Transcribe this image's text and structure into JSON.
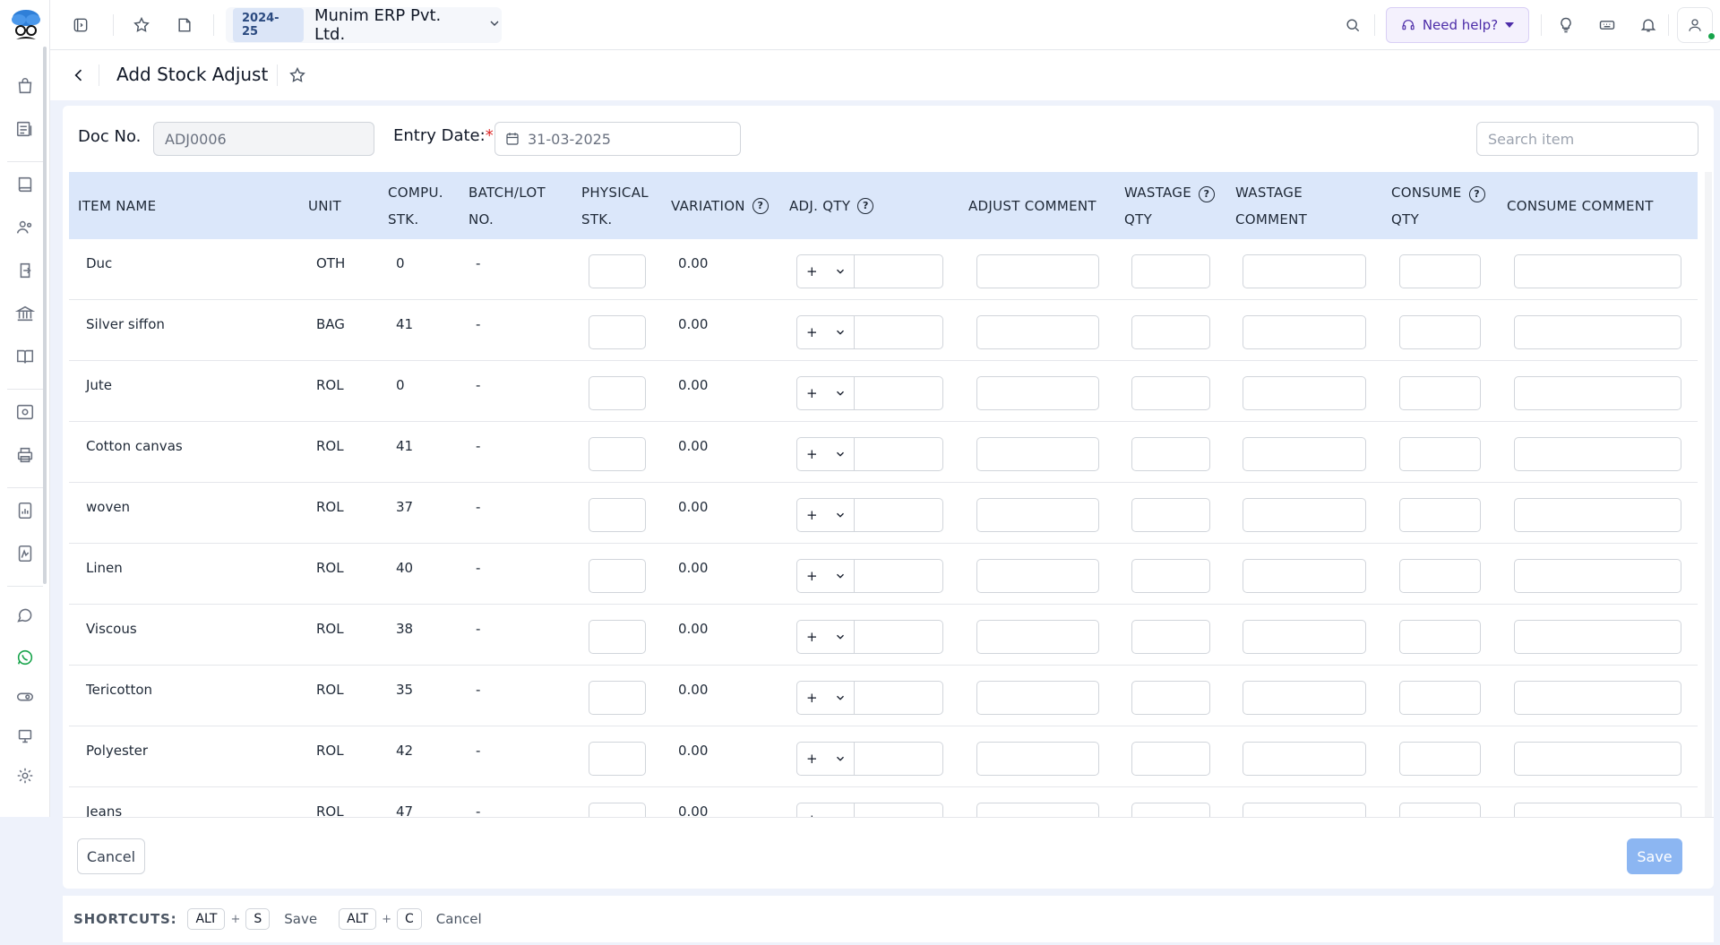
{
  "app": {
    "financial_year": "2024-25",
    "company_name": "Munim ERP Pvt. Ltd.",
    "help_label": "Need help?"
  },
  "page": {
    "title": "Add Stock Adjust"
  },
  "form": {
    "doc_no_label": "Doc No.",
    "doc_no_value": "ADJ0006",
    "entry_date_label": "Entry Date:",
    "entry_date_required": "*",
    "entry_date_value": "31-03-2025",
    "search_placeholder": "Search item"
  },
  "table": {
    "headers": {
      "item_name": "ITEM NAME",
      "unit": "UNIT",
      "compu_stk_1": "COMPU.",
      "compu_stk_2": "STK.",
      "batch_1": "BATCH/LOT",
      "batch_2": "NO.",
      "physical_1": "PHYSICAL",
      "physical_2": "STK.",
      "variation": "VARIATION",
      "adj_qty": "ADJ. QTY",
      "adjust_comment": "ADJUST COMMENT",
      "wastage_qty_1": "WASTAGE",
      "wastage_qty_2": "QTY",
      "wastage_comment_1": "WASTAGE",
      "wastage_comment_2": "COMMENT",
      "consume_qty_1": "CONSUME",
      "consume_qty_2": "QTY",
      "consume_comment": "CONSUME COMMENT",
      "help_glyph": "?"
    },
    "rows": [
      {
        "item": "Duc",
        "unit": "OTH",
        "compu_stk": "0",
        "batch": "-",
        "variation": "0.00",
        "sign": "+"
      },
      {
        "item": "Silver siffon",
        "unit": "BAG",
        "compu_stk": "41",
        "batch": "-",
        "variation": "0.00",
        "sign": "+"
      },
      {
        "item": "Jute",
        "unit": "ROL",
        "compu_stk": "0",
        "batch": "-",
        "variation": "0.00",
        "sign": "+"
      },
      {
        "item": "Cotton canvas",
        "unit": "ROL",
        "compu_stk": "41",
        "batch": "-",
        "variation": "0.00",
        "sign": "+"
      },
      {
        "item": "woven",
        "unit": "ROL",
        "compu_stk": "37",
        "batch": "-",
        "variation": "0.00",
        "sign": "+"
      },
      {
        "item": "Linen",
        "unit": "ROL",
        "compu_stk": "40",
        "batch": "-",
        "variation": "0.00",
        "sign": "+"
      },
      {
        "item": "Viscous",
        "unit": "ROL",
        "compu_stk": "38",
        "batch": "-",
        "variation": "0.00",
        "sign": "+"
      },
      {
        "item": "Tericotton",
        "unit": "ROL",
        "compu_stk": "35",
        "batch": "-",
        "variation": "0.00",
        "sign": "+"
      },
      {
        "item": "Polyester",
        "unit": "ROL",
        "compu_stk": "42",
        "batch": "-",
        "variation": "0.00",
        "sign": "+"
      },
      {
        "item": "Jeans",
        "unit": "ROL",
        "compu_stk": "47",
        "batch": "-",
        "variation": "0.00",
        "sign": "+"
      }
    ]
  },
  "actions": {
    "cancel_label": "Cancel",
    "save_label": "Save"
  },
  "shortcuts": {
    "title": "SHORTCUTS:",
    "items": [
      {
        "key1": "ALT",
        "plus": "+",
        "key2": "S",
        "label": "Save"
      },
      {
        "key1": "ALT",
        "plus": "+",
        "key2": "C",
        "label": "Cancel"
      }
    ]
  },
  "colors": {
    "header_bg": "#dbe7fa",
    "save_button": "#8cb6f2",
    "fy_badge": "#dbe5f7",
    "help_accent": "#4c2ca8"
  }
}
